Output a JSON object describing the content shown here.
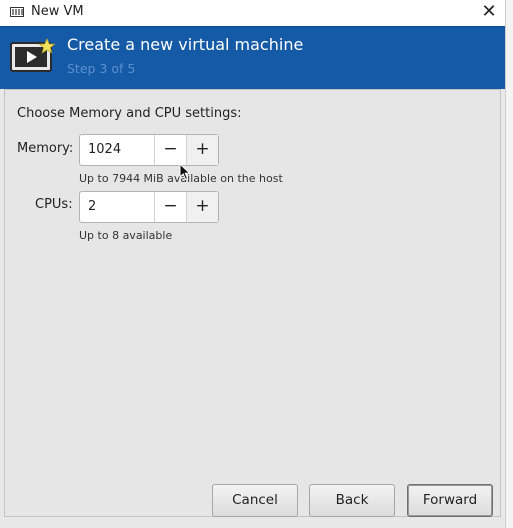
{
  "window": {
    "title": "New VM",
    "close_symbol": "✕"
  },
  "banner": {
    "title": "Create a new virtual machine",
    "step": "Step 3 of 5",
    "icon": "vm-new-icon"
  },
  "settings": {
    "heading": "Choose Memory and CPU settings:",
    "memory": {
      "label": "Memory:",
      "value": "1024",
      "hint": "Up to 7944 MiB available on the host"
    },
    "cpus": {
      "label": "CPUs:",
      "value": "2",
      "hint": "Up to 8 available"
    },
    "decrement_symbol": "−",
    "increment_symbol": "+"
  },
  "buttons": {
    "cancel": "Cancel",
    "back": "Back",
    "forward": "Forward"
  },
  "colors": {
    "banner": "#155aa6",
    "step_text": "#5b8fd0"
  }
}
